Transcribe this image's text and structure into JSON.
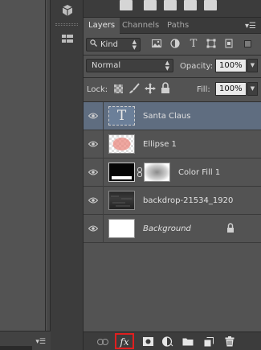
{
  "left_footer": {
    "menu_icon": "panel-menu-icon"
  },
  "panel": {
    "tabs": [
      {
        "label": "Layers",
        "active": true
      },
      {
        "label": "Channels",
        "active": false
      },
      {
        "label": "Paths",
        "active": false
      }
    ],
    "filter": {
      "kind_label": "Kind"
    },
    "blend": {
      "mode": "Normal",
      "opacity_label": "Opacity:",
      "opacity_value": "100%"
    },
    "lock": {
      "label": "Lock:",
      "fill_label": "Fill:",
      "fill_value": "100%"
    },
    "layers": [
      {
        "name": "Santa Claus",
        "type": "text",
        "selected": true,
        "thumb_glyph": "T"
      },
      {
        "name": "Ellipse 1",
        "type": "shape",
        "selected": false
      },
      {
        "name": "Color Fill 1",
        "type": "fill",
        "selected": false
      },
      {
        "name": "backdrop-21534_1920",
        "type": "image",
        "selected": false
      },
      {
        "name": "Background",
        "type": "background",
        "selected": false,
        "locked": true
      }
    ],
    "footer_icons": [
      "link-icon",
      "fx-icon",
      "mask-icon",
      "adjustment-icon",
      "folder-icon",
      "new-layer-icon",
      "trash-icon"
    ],
    "fx_label": "fx",
    "highlight_color": "#e01f1f"
  }
}
